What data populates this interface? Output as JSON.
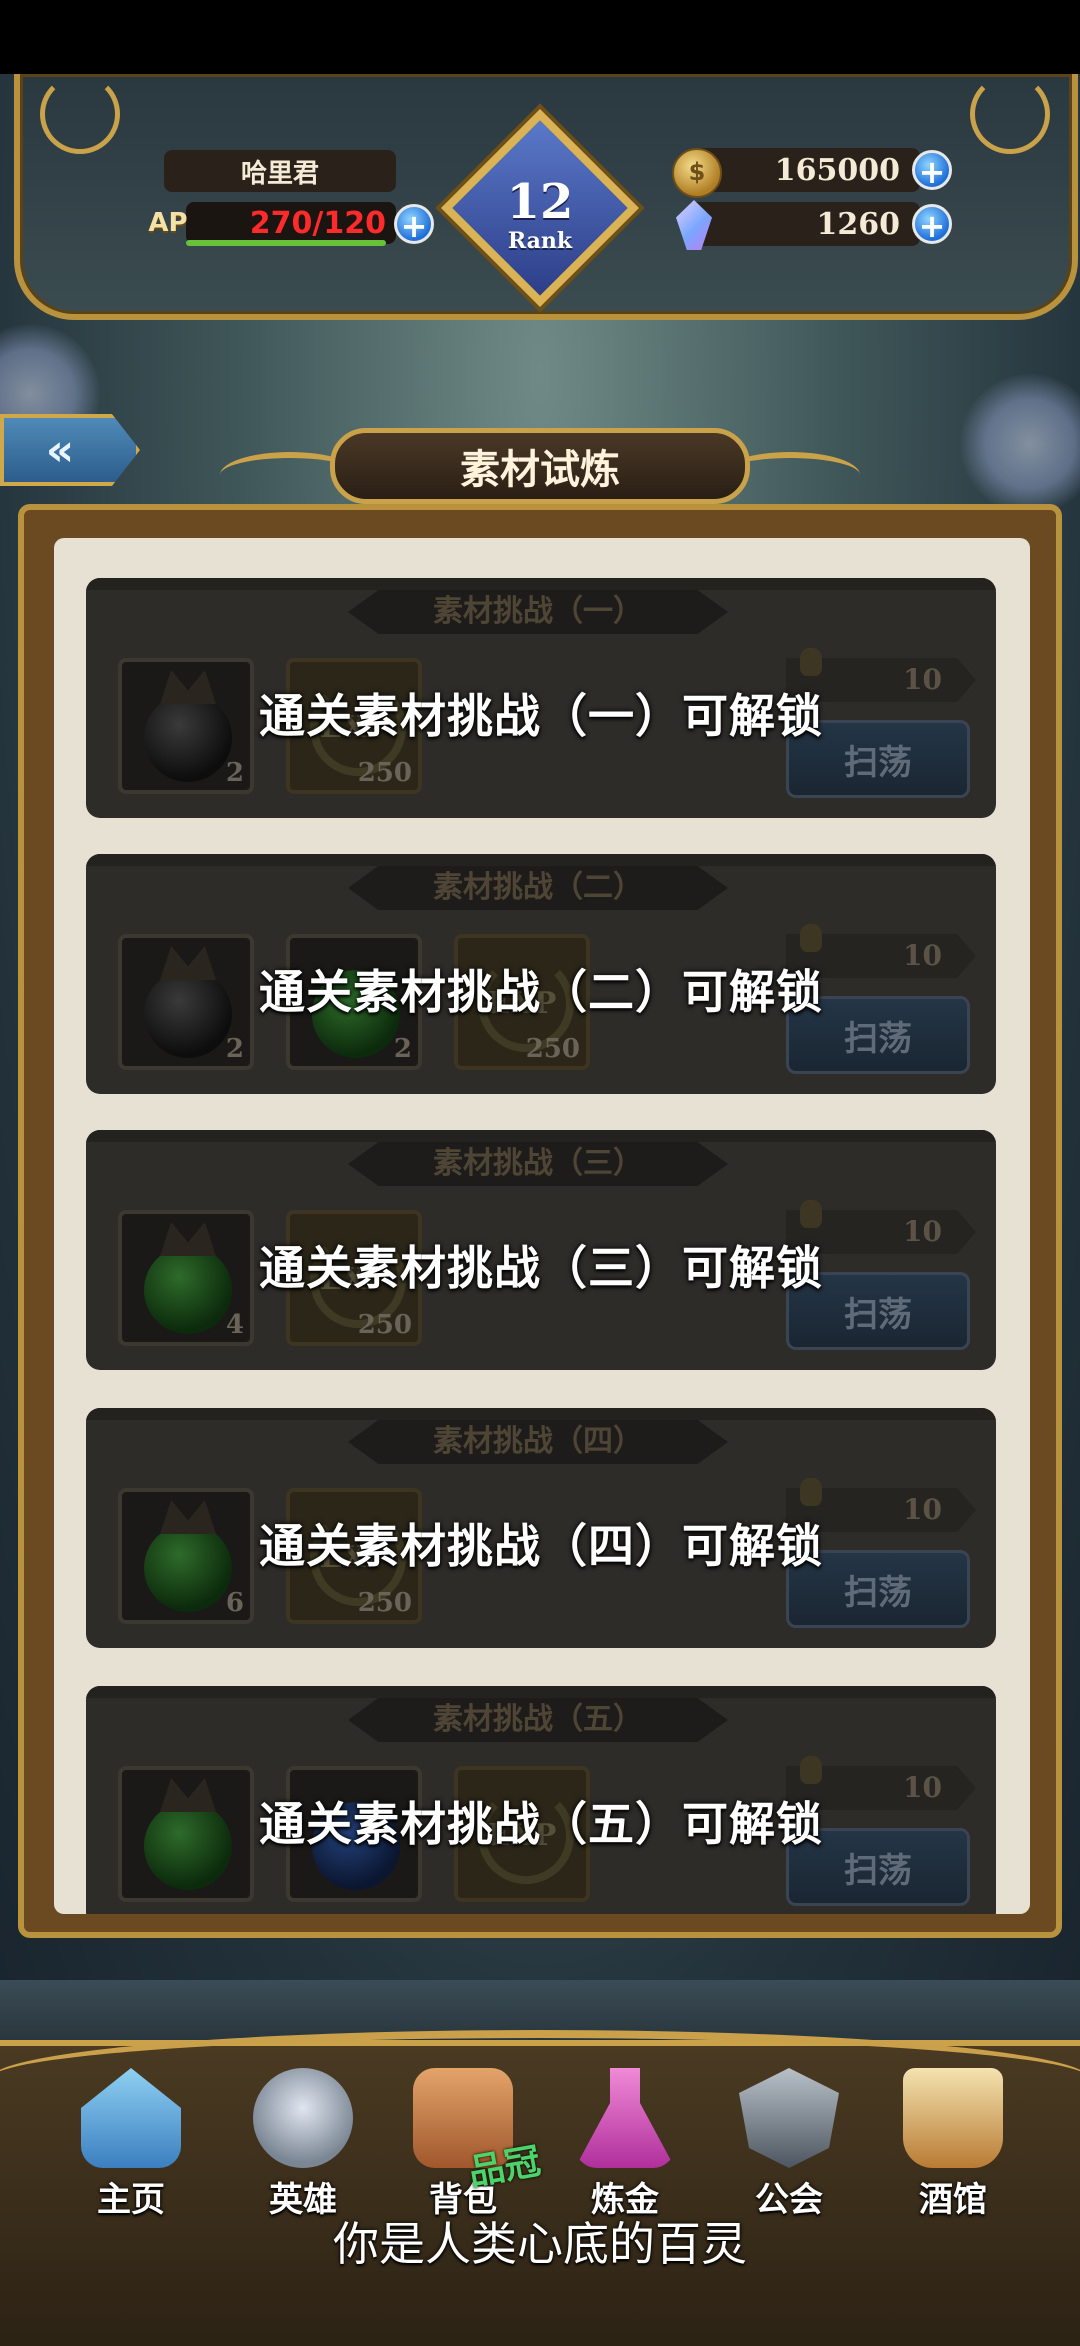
{
  "player": {
    "name": "哈里君",
    "ap_label": "AP",
    "ap_value": "270/120",
    "rank_number": "12",
    "rank_label": "Rank",
    "gold": "165000",
    "crystals": "1260"
  },
  "page": {
    "title": "素材试炼",
    "back_icon": "double-chevron-left-icon"
  },
  "challenges": [
    {
      "tab": "素材挑战（一）",
      "lock_text": "通关素材挑战（一）可解锁",
      "rewards": [
        {
          "type": "black-orb",
          "qty": "2"
        },
        {
          "type": "exp",
          "qty": "250"
        }
      ],
      "cost": "10",
      "sweep_label": "扫荡"
    },
    {
      "tab": "素材挑战（二）",
      "lock_text": "通关素材挑战（二）可解锁",
      "rewards": [
        {
          "type": "black-orb",
          "qty": "2"
        },
        {
          "type": "green-orb",
          "qty": "2"
        },
        {
          "type": "exp",
          "qty": "250"
        }
      ],
      "cost": "10",
      "sweep_label": "扫荡"
    },
    {
      "tab": "素材挑战（三）",
      "lock_text": "通关素材挑战（三）可解锁",
      "rewards": [
        {
          "type": "green-orb",
          "qty": "4"
        },
        {
          "type": "exp",
          "qty": "250"
        }
      ],
      "cost": "10",
      "sweep_label": "扫荡"
    },
    {
      "tab": "素材挑战（四）",
      "lock_text": "通关素材挑战（四）可解锁",
      "rewards": [
        {
          "type": "green-orb",
          "qty": "6"
        },
        {
          "type": "exp",
          "qty": "250"
        }
      ],
      "cost": "10",
      "sweep_label": "扫荡"
    },
    {
      "tab": "素材挑战（五）",
      "lock_text": "通关素材挑战（五）可解锁",
      "rewards": [
        {
          "type": "green-orb",
          "qty": ""
        },
        {
          "type": "blue-orb",
          "qty": ""
        },
        {
          "type": "exp",
          "qty": ""
        }
      ],
      "cost": "10",
      "sweep_label": "扫荡"
    }
  ],
  "exp_label": "EXP",
  "nav": [
    {
      "label": "主页",
      "icon": "castle-icon"
    },
    {
      "label": "英雄",
      "icon": "helmet-icon"
    },
    {
      "label": "背包",
      "icon": "backpack-icon"
    },
    {
      "label": "炼金",
      "icon": "potion-icon"
    },
    {
      "label": "公会",
      "icon": "guild-shield-icon"
    },
    {
      "label": "酒馆",
      "icon": "beer-mug-icon"
    }
  ],
  "overlay": {
    "caption": "你是人类心底的百灵",
    "mark": "品冠"
  }
}
